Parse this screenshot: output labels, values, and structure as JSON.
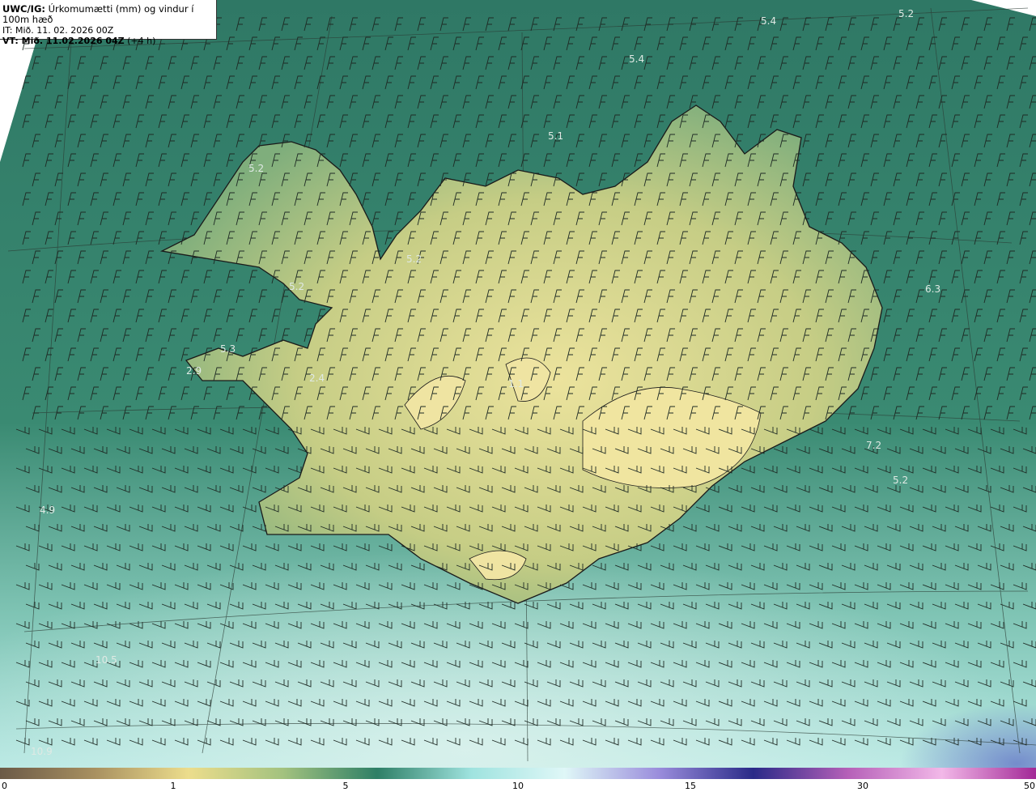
{
  "header": {
    "product": "UWC/IG:",
    "description": "Úrkomumætti (mm) og vindur í 100m hæð",
    "initial_time": "IT: Mið. 11. 02. 2026 00Z",
    "valid_prefix": "VT: Mið. 11.02.2026 04Z",
    "valid_suffix": "(+4 h)"
  },
  "map_values": [
    "5.4",
    "5.2",
    "5.4",
    "5.1",
    "5.2",
    "5.2",
    "5.2",
    "5.3",
    "2.9",
    "2.4",
    "1.1",
    "6.3",
    "7.2",
    "5.2",
    "4.9",
    "10.5",
    "10.9"
  ],
  "colorbar": {
    "tick_labels": [
      "0",
      "1",
      "5",
      "10",
      "15",
      "30",
      "50"
    ],
    "stops": [
      "#6b5a47",
      "#a89060",
      "#ecdd8c",
      "#a3c27f",
      "#2e7f66",
      "#9fe3df",
      "#dff7f7",
      "#9a8ddc",
      "#2a2a88",
      "#b560b8",
      "#f2b8e8",
      "#a22896"
    ]
  },
  "colors": {
    "ocean": "#2e7a66",
    "land": "#c9cf86",
    "highland": "#e6de98",
    "southsea": "#9fd9d2"
  }
}
